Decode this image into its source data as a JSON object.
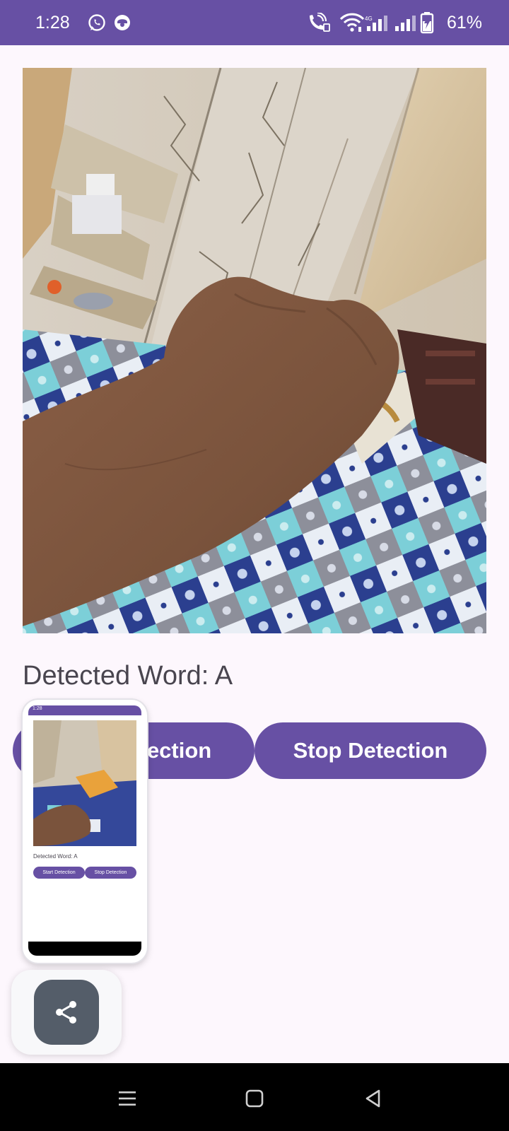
{
  "status_bar": {
    "time": "1:28",
    "battery_percent": "61%",
    "icons": [
      "whatsapp-icon",
      "notification-app-icon",
      "wifi-calling-icon",
      "wifi-icon",
      "signal-icon-sim1",
      "signal-icon-sim2",
      "battery-charging-icon"
    ],
    "background_color": "#6750a4"
  },
  "camera": {
    "description_icon": "camera-preview"
  },
  "detection": {
    "label": "Detected Word: ",
    "word": "A"
  },
  "buttons": {
    "start_label": "Start Detection",
    "stop_label": "Stop Detection",
    "color": "#6750a4"
  },
  "thumbnail": {
    "time": "1:28",
    "detected_text": "Detected Word: A",
    "start_label": "Start Detection",
    "stop_label": "Stop Detection"
  },
  "share": {
    "icon": "share-icon"
  },
  "nav_bar": {
    "icons": [
      "recent-apps-icon",
      "home-icon",
      "back-icon"
    ]
  }
}
